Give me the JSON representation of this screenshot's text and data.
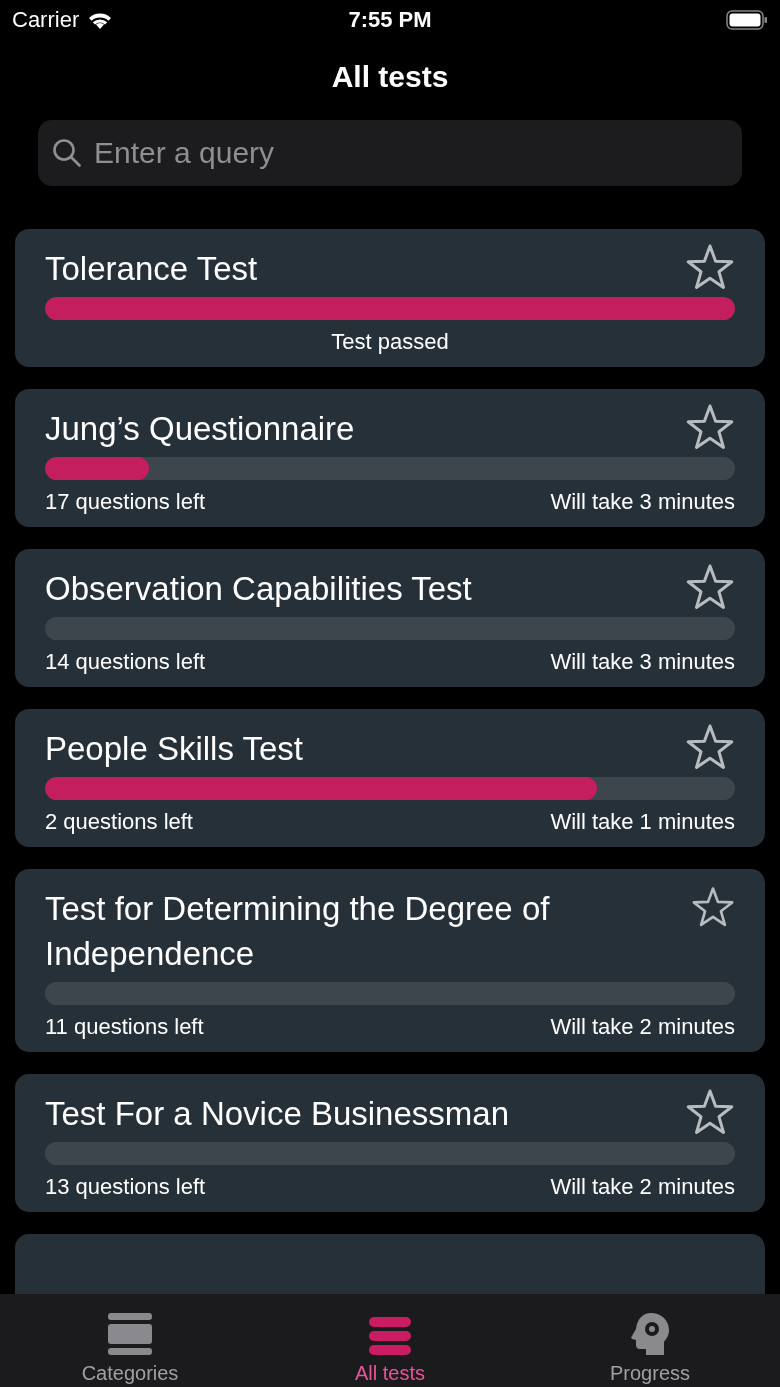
{
  "status_bar": {
    "carrier": "Carrier",
    "time": "7:55 PM"
  },
  "title": "All tests",
  "search": {
    "placeholder": "Enter a query"
  },
  "tests": [
    {
      "kind": "passed",
      "title": "Tolerance Test",
      "favorite": false,
      "level": 1,
      "status": "Test passed"
    },
    {
      "kind": "progress",
      "title": "Jung’s Questionnaire",
      "favorite": false,
      "level": 0.15,
      "questions_left": "17 questions left",
      "duration": "Will take 3 minutes"
    },
    {
      "kind": "progress",
      "title": "Observation Capabilities Test",
      "favorite": false,
      "level": 0,
      "questions_left": "14 questions left",
      "duration": "Will take 3 minutes"
    },
    {
      "kind": "progress",
      "title": "People Skills Test",
      "favorite": false,
      "level": 0.8,
      "questions_left": "2 questions left",
      "duration": "Will take 1 minutes"
    },
    {
      "kind": "progress",
      "title": "Test for Determining the Degree of Independence",
      "favorite": false,
      "level": 0,
      "questions_left": "11 questions left",
      "duration": "Will take 2 minutes"
    },
    {
      "kind": "progress",
      "title": "Test For a Novice Businessman",
      "favorite": false,
      "level": 0,
      "questions_left": "13 questions left",
      "duration": "Will take 2 minutes"
    },
    {
      "kind": "cut"
    }
  ],
  "tab_bar": [
    {
      "kind": "categories",
      "label": "Categories",
      "selected": false
    },
    {
      "kind": "list",
      "label": "All tests",
      "selected": true
    },
    {
      "kind": "head",
      "label": "Progress",
      "selected": false
    }
  ]
}
